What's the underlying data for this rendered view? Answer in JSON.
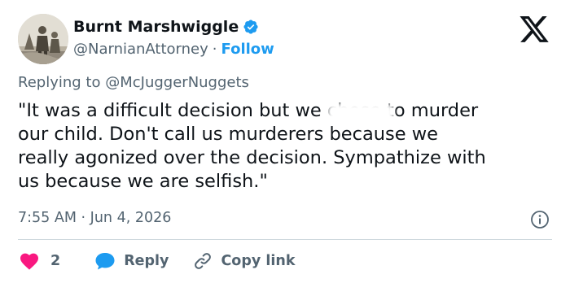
{
  "author": {
    "name": "Burnt Marshwiggle",
    "handle": "@NarnianAttorney",
    "separator": "·",
    "follow_label": "Follow"
  },
  "reply_context": {
    "prefix": "Replying to",
    "handle": "@McJuggerNuggets"
  },
  "tweet": {
    "text": "\"It was a difficult decision but we chose to murder\nour child. Don't call us murderers because we\nreally agonized over the decision. Sympathize with\nus because we are selfish.\"",
    "time": "7:55 AM",
    "separator": "·",
    "date": "Jun 4, 2026"
  },
  "actions": {
    "like_count": "2",
    "reply_label": "Reply",
    "copy_link_label": "Copy link"
  },
  "icons": {
    "verified": "verified-badge-icon",
    "logo": "x-logo-icon",
    "info": "info-icon",
    "like": "heart-icon",
    "reply": "speech-bubble-icon",
    "copy": "link-icon"
  },
  "colors": {
    "accent": "#1d9bf0",
    "like": "#f91880",
    "text": "#0f1419",
    "muted": "#536471",
    "divider": "#cfd9de"
  }
}
